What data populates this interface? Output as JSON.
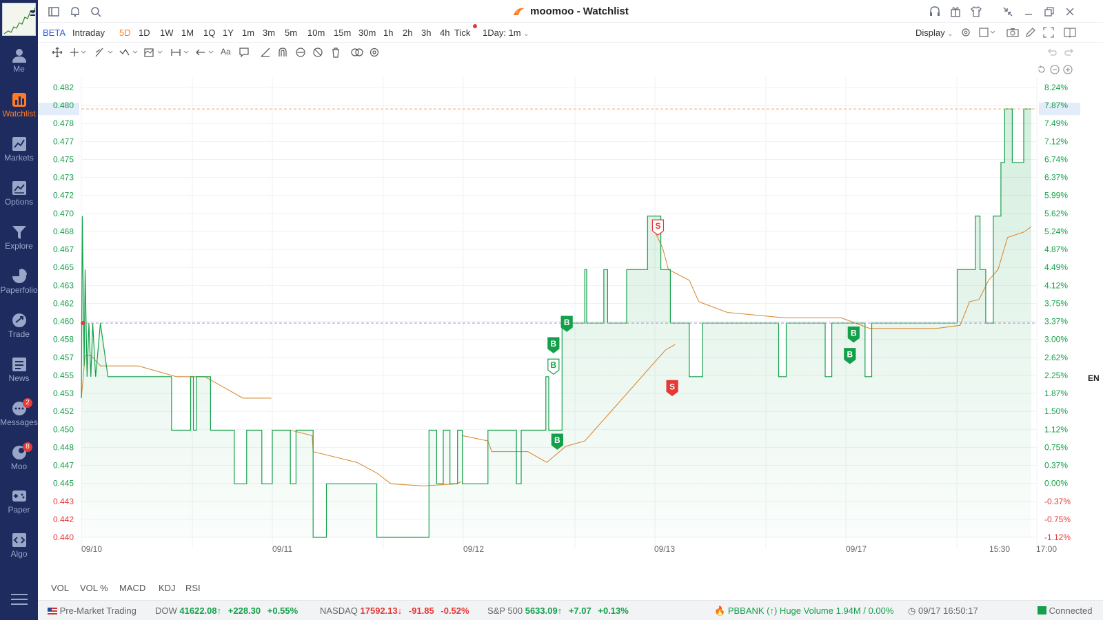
{
  "window": {
    "title": "moomoo - Watchlist"
  },
  "sidebar": {
    "items": [
      {
        "label": "Me",
        "icon": "user-icon"
      },
      {
        "label": "Watchlist",
        "icon": "bar-chart-icon",
        "active": true
      },
      {
        "label": "Markets",
        "icon": "markets-icon"
      },
      {
        "label": "Options",
        "icon": "options-icon"
      },
      {
        "label": "Explore",
        "icon": "funnel-icon"
      },
      {
        "label": "Paperfolio",
        "icon": "pie-icon"
      },
      {
        "label": "Trade",
        "icon": "trade-icon"
      },
      {
        "label": "News",
        "icon": "news-icon"
      },
      {
        "label": "Messages",
        "icon": "chat-icon",
        "badge": "2"
      },
      {
        "label": "Moo",
        "icon": "moo-icon",
        "badge": "8"
      },
      {
        "label": "Paper",
        "icon": "gamepad-icon"
      },
      {
        "label": "Algo",
        "icon": "code-icon"
      }
    ]
  },
  "periodbar": {
    "beta": "BETA",
    "periods": [
      "Intraday",
      "5D",
      "1D",
      "1W",
      "1M",
      "1Q",
      "1Y",
      "1m",
      "3m",
      "5m",
      "10m",
      "15m",
      "30m",
      "1h",
      "2h",
      "3h",
      "4h",
      "Tick"
    ],
    "selected": "5D",
    "interval": "1Day: 1m",
    "display": "Display"
  },
  "chart_data": {
    "type": "line",
    "y_ticks": [
      "0.482",
      "0.480",
      "0.478",
      "0.477",
      "0.475",
      "0.473",
      "0.472",
      "0.470",
      "0.468",
      "0.467",
      "0.465",
      "0.463",
      "0.462",
      "0.460",
      "0.458",
      "0.457",
      "0.455",
      "0.453",
      "0.452",
      "0.450",
      "0.448",
      "0.447",
      "0.445",
      "0.443",
      "0.442",
      "0.440"
    ],
    "y_right_ticks": [
      "8.24%",
      "7.87%",
      "7.49%",
      "7.12%",
      "6.74%",
      "6.37%",
      "5.99%",
      "5.62%",
      "5.24%",
      "4.87%",
      "4.49%",
      "4.12%",
      "3.75%",
      "3.37%",
      "3.00%",
      "2.62%",
      "2.25%",
      "1.87%",
      "1.50%",
      "1.12%",
      "0.75%",
      "0.37%",
      "0.00%",
      "-0.37%",
      "-0.75%",
      "-1.12%"
    ],
    "x_ticks": [
      "09/10",
      "09/11",
      "09/12",
      "09/13",
      "09/17",
      "15:30",
      "17:00"
    ],
    "ylim": [
      0.44,
      0.482
    ],
    "reference_price": 0.46,
    "current_price": 0.48,
    "colors": {
      "price": "#14a04a",
      "avg": "#d98c3a",
      "fill": "#14a04a",
      "up": "#14a04a",
      "down": "#e53935",
      "ref": "#9a90c8",
      "current": "#f5a25d"
    },
    "series": [],
    "markers": [
      {
        "label": "B",
        "price": 0.46
      },
      {
        "label": "B",
        "price": 0.458
      },
      {
        "label": "B",
        "price": 0.456
      },
      {
        "label": "B",
        "price": 0.449
      },
      {
        "label": "S",
        "price": 0.469
      },
      {
        "label": "S",
        "price": 0.454
      },
      {
        "label": "B",
        "price": 0.459
      },
      {
        "label": "B",
        "price": 0.457
      }
    ]
  },
  "indicators": [
    "VOL",
    "VOL %",
    "MACD",
    "KDJ",
    "RSI"
  ],
  "statusbar": {
    "session": "Pre-Market Trading",
    "dow": {
      "name": "DOW",
      "value": "41622.08↑",
      "change": "+228.30",
      "pct": "+0.55%"
    },
    "nasdaq": {
      "name": "NASDAQ",
      "value": "17592.13↓",
      "change": "-91.85",
      "pct": "-0.52%"
    },
    "sp500": {
      "name": "S&P 500",
      "value": "5633.09↑",
      "change": "+7.07",
      "pct": "+0.13%"
    },
    "alert": "PBBANK (↑) Huge Volume 1.94M / 0.00%",
    "datetime": "09/17 16:50:17",
    "connection": "Connected"
  },
  "ime": "EN"
}
